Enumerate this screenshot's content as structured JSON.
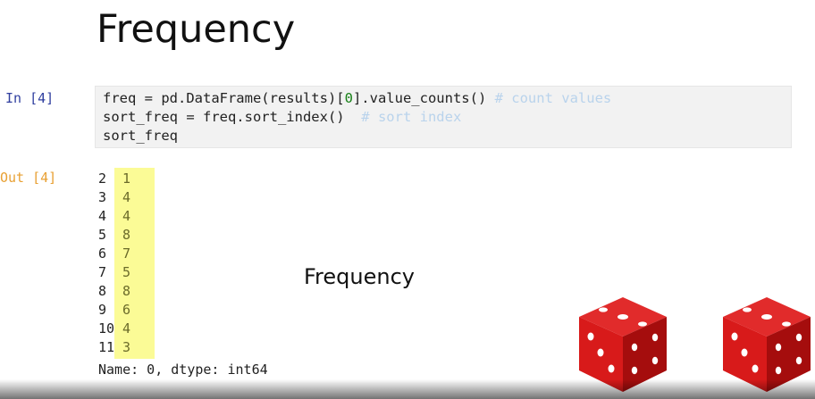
{
  "slide": {
    "title": "Frequency",
    "center_label": "Frequency"
  },
  "cell": {
    "in_prompt": "In [4]",
    "out_prompt": "Out [4]",
    "code": {
      "line1": {
        "a": "freq = pd.DataFrame(results)[",
        "num": "0",
        "b": "].value_counts() ",
        "comment": "# count values"
      },
      "line2": {
        "a": "sort_freq = freq.sort_index()  ",
        "comment": "# sort index"
      },
      "line3": {
        "a": "sort_freq"
      }
    },
    "output_rows": [
      {
        "index": "2",
        "value": "1"
      },
      {
        "index": "3",
        "value": "4"
      },
      {
        "index": "4",
        "value": "4"
      },
      {
        "index": "5",
        "value": "8"
      },
      {
        "index": "6",
        "value": "7"
      },
      {
        "index": "7",
        "value": "5"
      },
      {
        "index": "8",
        "value": "8"
      },
      {
        "index": "9",
        "value": "6"
      },
      {
        "index": "10",
        "value": "4"
      },
      {
        "index": "11",
        "value": "3"
      }
    ],
    "dtype_line": "Name: 0, dtype: int64"
  },
  "colors": {
    "die_face": "#d81a1a",
    "die_side": "#a50d0d",
    "highlight": "#fbfb96",
    "in_prompt": "#303f9f",
    "out_prompt": "#e8a033"
  },
  "icons": [
    "red-die-icon",
    "red-die-icon"
  ]
}
